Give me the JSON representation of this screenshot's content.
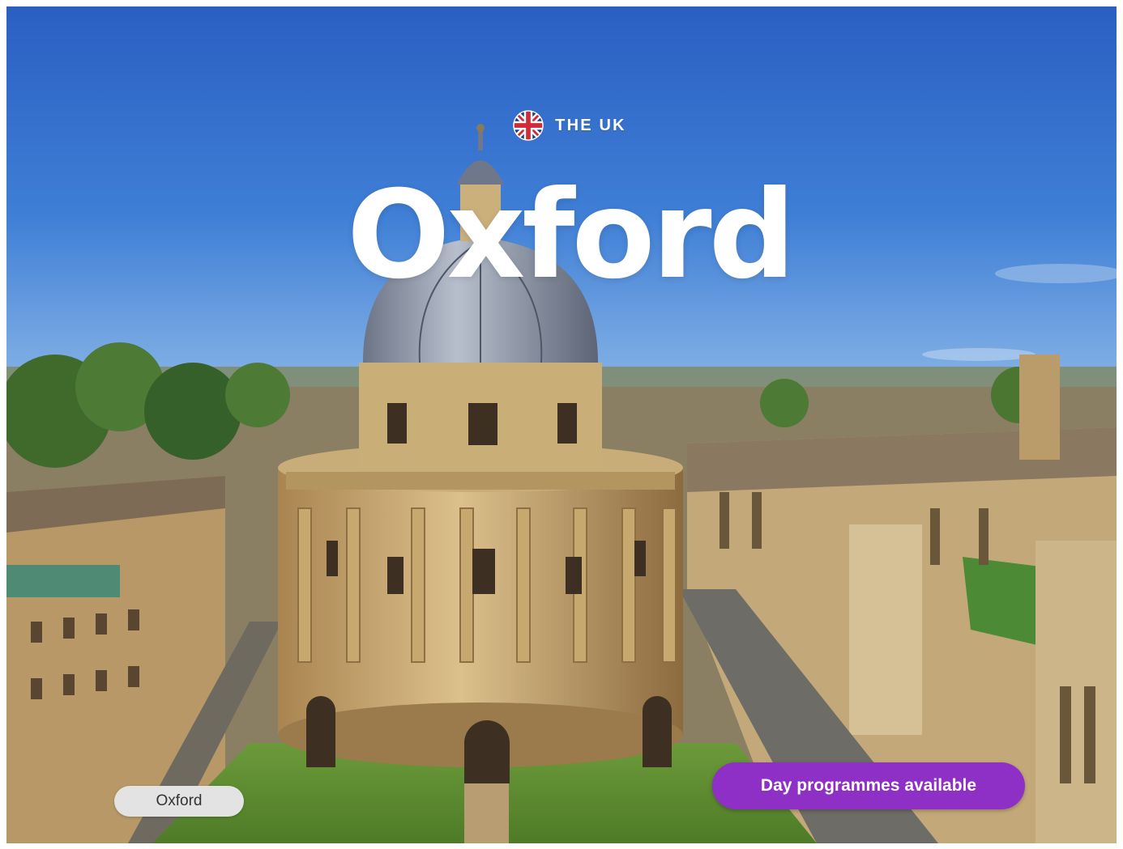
{
  "header": {
    "country": "THE UK",
    "title": "Oxford"
  },
  "flag_icon": "union-jack-flag-icon",
  "photo_subject": "oxford-radcliffe-camera-aerial",
  "location_chip": "Oxford",
  "cta": {
    "label": "Day programmes available"
  },
  "colors": {
    "cta_background": "#8e2fc6",
    "chip_background": "#e3e3e3",
    "title_text": "#ffffff",
    "sky": "#2f65c8"
  }
}
